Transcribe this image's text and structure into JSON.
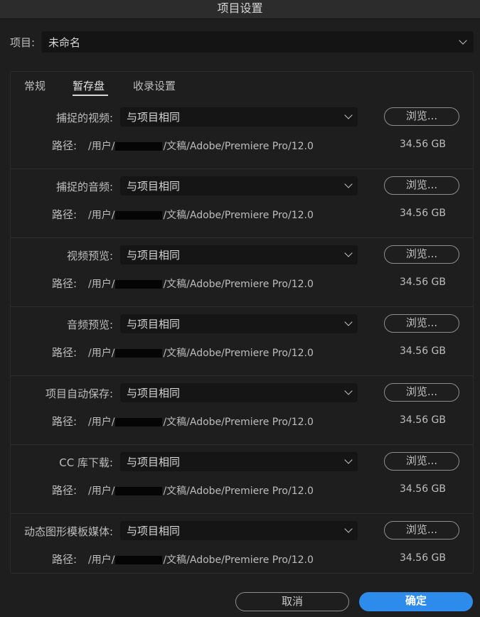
{
  "window": {
    "title": "项目设置"
  },
  "project": {
    "label": "项目:",
    "value": "未命名"
  },
  "tabs": [
    {
      "label": "常规",
      "active": false
    },
    {
      "label": "暂存盘",
      "active": true
    },
    {
      "label": "收录设置",
      "active": false
    }
  ],
  "rows": [
    {
      "label": "捕捉的视频:",
      "value": "与项目相同",
      "browse": "浏览...",
      "path_label": "路径:",
      "path_prefix": "/用户/",
      "path_suffix": "/文稿/Adobe/Premiere Pro/12.0",
      "size": "34.56 GB"
    },
    {
      "label": "捕捉的音频:",
      "value": "与项目相同",
      "browse": "浏览...",
      "path_label": "路径:",
      "path_prefix": "/用户/",
      "path_suffix": "/文稿/Adobe/Premiere Pro/12.0",
      "size": "34.56 GB"
    },
    {
      "label": "视频预览:",
      "value": "与项目相同",
      "browse": "浏览...",
      "path_label": "路径:",
      "path_prefix": "/用户/",
      "path_suffix": "/文稿/Adobe/Premiere Pro/12.0",
      "size": "34.56 GB"
    },
    {
      "label": "音频预览:",
      "value": "与项目相同",
      "browse": "浏览...",
      "path_label": "路径:",
      "path_prefix": "/用户/",
      "path_suffix": "/文稿/Adobe/Premiere Pro/12.0",
      "size": "34.56 GB"
    },
    {
      "label": "项目自动保存:",
      "value": "与项目相同",
      "browse": "浏览...",
      "path_label": "路径:",
      "path_prefix": "/用户/",
      "path_suffix": "/文稿/Adobe/Premiere Pro/12.0",
      "size": "34.56 GB"
    },
    {
      "label": "CC 库下载:",
      "value": "与项目相同",
      "browse": "浏览...",
      "path_label": "路径:",
      "path_prefix": "/用户/",
      "path_suffix": "/文稿/Adobe/Premiere Pro/12.0",
      "size": "34.56 GB"
    },
    {
      "label": "动态图形模板媒体:",
      "value": "与项目相同",
      "browse": "浏览...",
      "path_label": "路径:",
      "path_prefix": "/用户/",
      "path_suffix": "/文稿/Adobe/Premiere Pro/12.0",
      "size": "34.56 GB"
    }
  ],
  "footer": {
    "cancel": "取消",
    "ok": "确定"
  },
  "colors": {
    "accent": "#2d8ceb",
    "background": "#1e1e1e",
    "field": "#151515"
  },
  "icons": {
    "dropdown": "chevron-down-icon"
  }
}
